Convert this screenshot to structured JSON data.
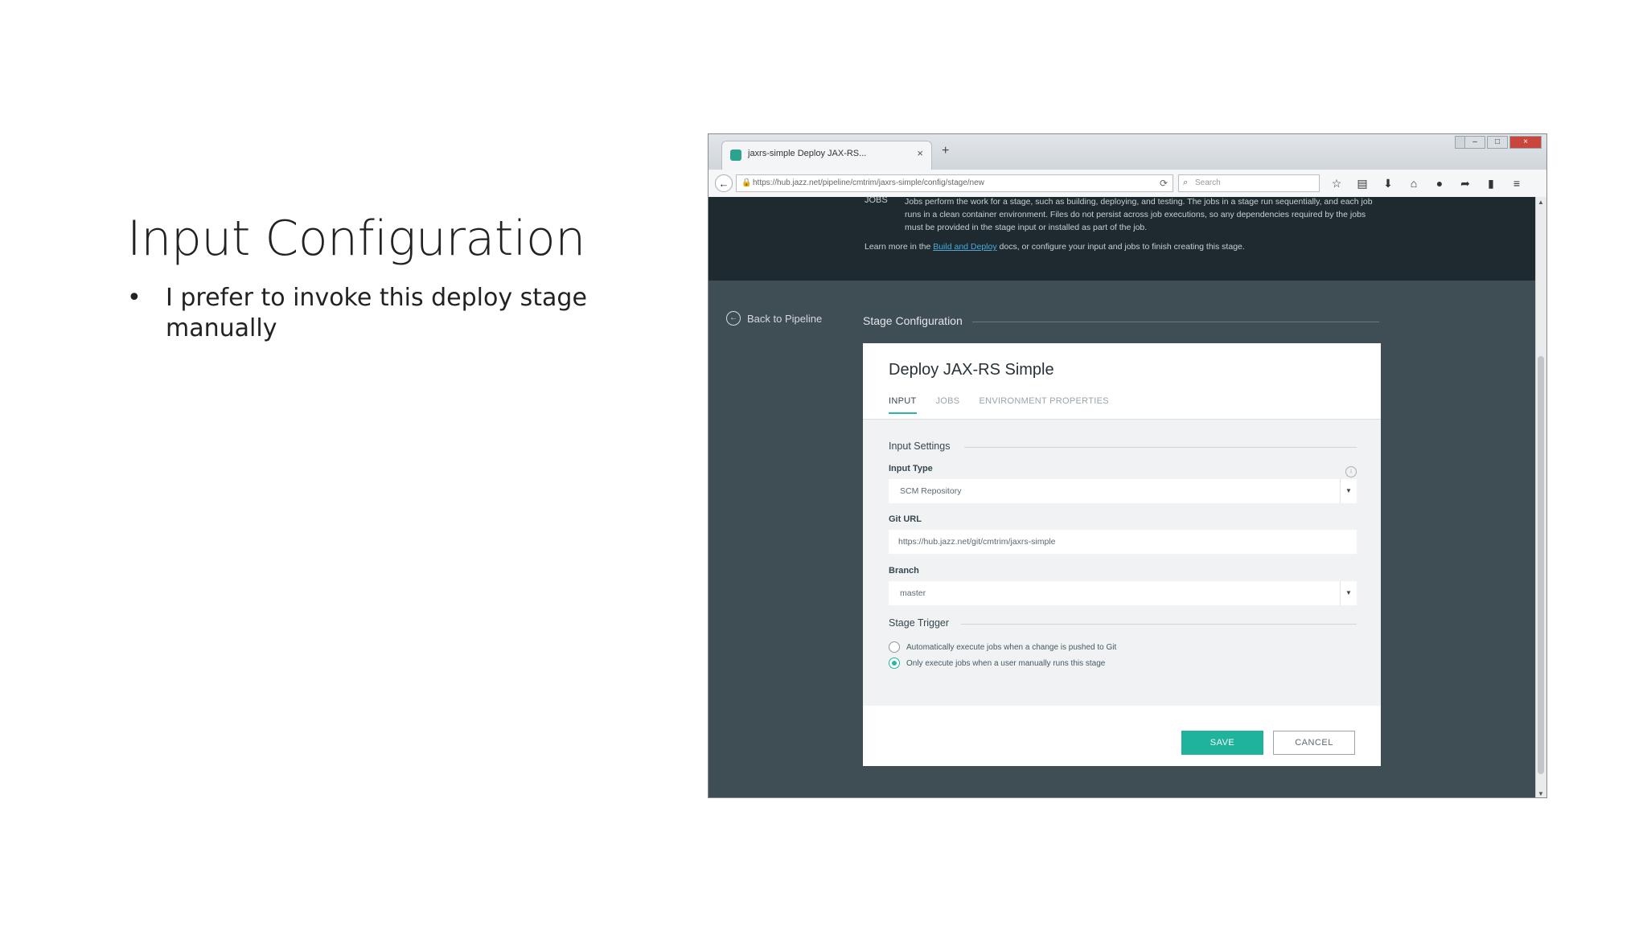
{
  "slide": {
    "title": "Input Configuration",
    "bullet_symbol": "•",
    "bullet": "I prefer to invoke this deploy stage manually"
  },
  "browser": {
    "tab_title": "jaxrs-simple Deploy JAX-RS...",
    "tab_close": "×",
    "new_tab": "+",
    "url": "https://hub.jazz.net/pipeline/cmtrim/jaxrs-simple/config/stage/new",
    "search_placeholder": "Search",
    "icons": [
      "star-icon",
      "bookmarks-icon",
      "download-icon",
      "home-icon",
      "chat-icon",
      "share-icon",
      "extension-icon",
      "menu-icon"
    ]
  },
  "hero": {
    "jobs_label": "JOBS",
    "jobs_description": "Jobs perform the work for a stage, such as building, deploying, and testing. The jobs in a stage run sequentially, and each job runs in a clean container environment. Files do not persist across job executions, so any dependencies required by the jobs must be provided in the stage input or installed as part of the job.",
    "learn_prefix": "Learn more in the ",
    "learn_link": "Build and Deploy",
    "learn_suffix": " docs, or configure your input and jobs to finish creating this stage."
  },
  "sidebar": {
    "back_label": "Back to Pipeline"
  },
  "stage_config": {
    "heading": "Stage Configuration",
    "card_title": "Deploy JAX-RS Simple",
    "tabs": [
      "INPUT",
      "JOBS",
      "ENVIRONMENT PROPERTIES"
    ],
    "input_settings": {
      "heading": "Input Settings",
      "input_type_label": "Input Type",
      "input_type_value": "SCM Repository",
      "git_url_label": "Git URL",
      "git_url_value": "https://hub.jazz.net/git/cmtrim/jaxrs-simple",
      "branch_label": "Branch",
      "branch_value": "master"
    },
    "stage_trigger": {
      "heading": "Stage Trigger",
      "options": [
        {
          "label": "Automatically execute jobs when a change is pushed to Git",
          "checked": false
        },
        {
          "label": "Only execute jobs when a user manually runs this stage",
          "checked": true
        }
      ]
    },
    "save_label": "SAVE",
    "cancel_label": "CANCEL"
  },
  "colors": {
    "accent": "#1fb39c",
    "hero_bg": "#1f2a30",
    "page_bg": "#3f4d54"
  }
}
